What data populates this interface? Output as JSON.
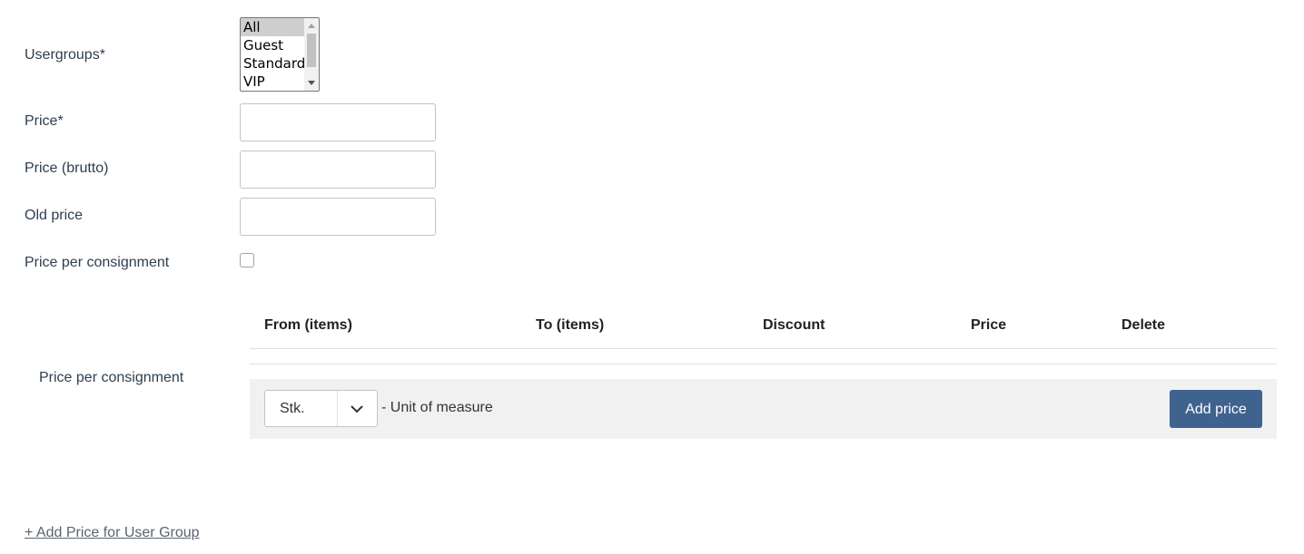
{
  "form": {
    "usergroups_label": "Usergroups*",
    "usergroups_options": [
      "All",
      "Guest",
      "Standard",
      "VIP"
    ],
    "usergroups_selected": "All",
    "price_label": "Price*",
    "price_value": "",
    "price_brutto_label": "Price (brutto)",
    "price_brutto_value": "",
    "old_price_label": "Old price",
    "old_price_value": "",
    "price_per_consignment_label": "Price per consignment",
    "price_per_consignment_checked": false
  },
  "consignment": {
    "section_label": "Price per consignment",
    "table": {
      "columns": [
        "From (items)",
        "To (items)",
        "Discount",
        "Price",
        "Delete"
      ],
      "rows": []
    },
    "unit_select_value": "Stk.",
    "unit_suffix": "- Unit of measure",
    "add_price_label": "Add price"
  },
  "add_group_link": "+ Add Price for User Group",
  "colors": {
    "primary_button": "#40628e",
    "footer_bar": "#f1f1f1",
    "input_border": "#b9c6d3"
  }
}
